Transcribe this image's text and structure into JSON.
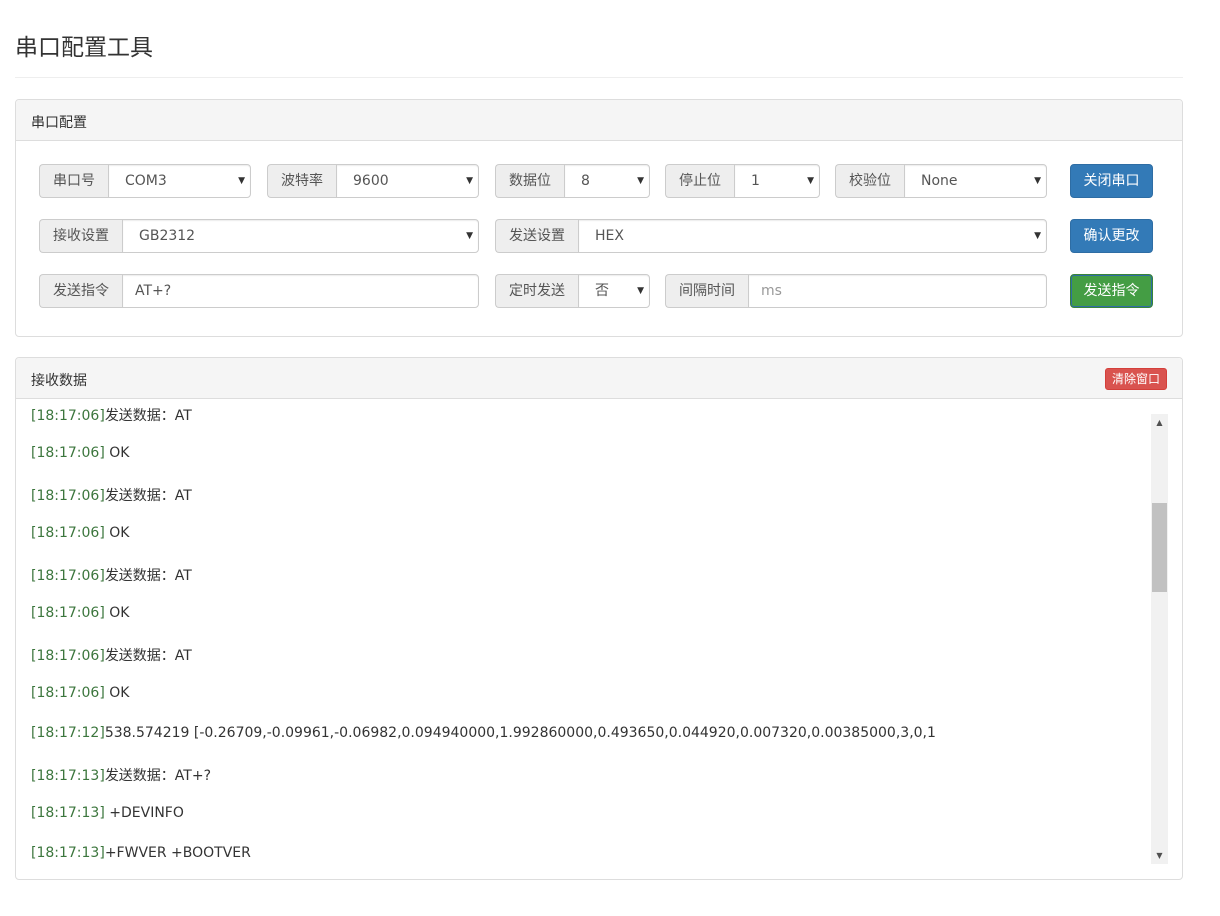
{
  "page": {
    "title": "串口配置工具"
  },
  "config": {
    "heading": "串口配置",
    "port": {
      "label": "串口号",
      "value": "COM3"
    },
    "baud": {
      "label": "波特率",
      "value": "9600"
    },
    "databits": {
      "label": "数据位",
      "value": "8"
    },
    "stopbits": {
      "label": "停止位",
      "value": "1"
    },
    "parity": {
      "label": "校验位",
      "value": "None"
    },
    "close_button": "关闭串口",
    "recv_setting": {
      "label": "接收设置",
      "value": "GB2312"
    },
    "send_setting": {
      "label": "发送设置",
      "value": "HEX"
    },
    "confirm_button": "确认更改",
    "command": {
      "label": "发送指令",
      "value": "AT+?"
    },
    "timed_send": {
      "label": "定时发送",
      "value": "否"
    },
    "interval": {
      "label": "间隔时间",
      "placeholder": "ms"
    },
    "send_button": "发送指令",
    "dropdown_icon": "caret-down-icon"
  },
  "receive": {
    "heading": "接收数据",
    "clear_button": "清除窗口",
    "lines": [
      {
        "ts": "[18:17:06]",
        "text": "发送数据：AT"
      },
      {
        "ts": "[18:17:06]",
        "text": " OK"
      },
      {
        "ts": "[18:17:06]",
        "text": "发送数据：AT"
      },
      {
        "ts": "[18:17:06]",
        "text": " OK"
      },
      {
        "ts": "[18:17:06]",
        "text": "发送数据：AT"
      },
      {
        "ts": "[18:17:06]",
        "text": " OK"
      },
      {
        "ts": "[18:17:06]",
        "text": "发送数据：AT"
      },
      {
        "ts": "[18:17:06]",
        "text": " OK"
      },
      {
        "ts": "[18:17:12]",
        "text": "538.574219 [-0.26709,-0.09961,-0.06982,0.094940000,1.992860000,0.493650,0.044920,0.007320,0.00385000,3,0,1"
      },
      {
        "ts": "[18:17:13]",
        "text": "发送数据：AT+?"
      },
      {
        "ts": "[18:17:13]",
        "text": " +DEVINFO"
      },
      {
        "ts": "[18:17:13]",
        "text": "+FWVER +BOOTVER"
      }
    ]
  },
  "colors": {
    "primary": "#337ab7",
    "success": "#449d44",
    "danger": "#d9534f",
    "timestamp": "#3c763d"
  }
}
